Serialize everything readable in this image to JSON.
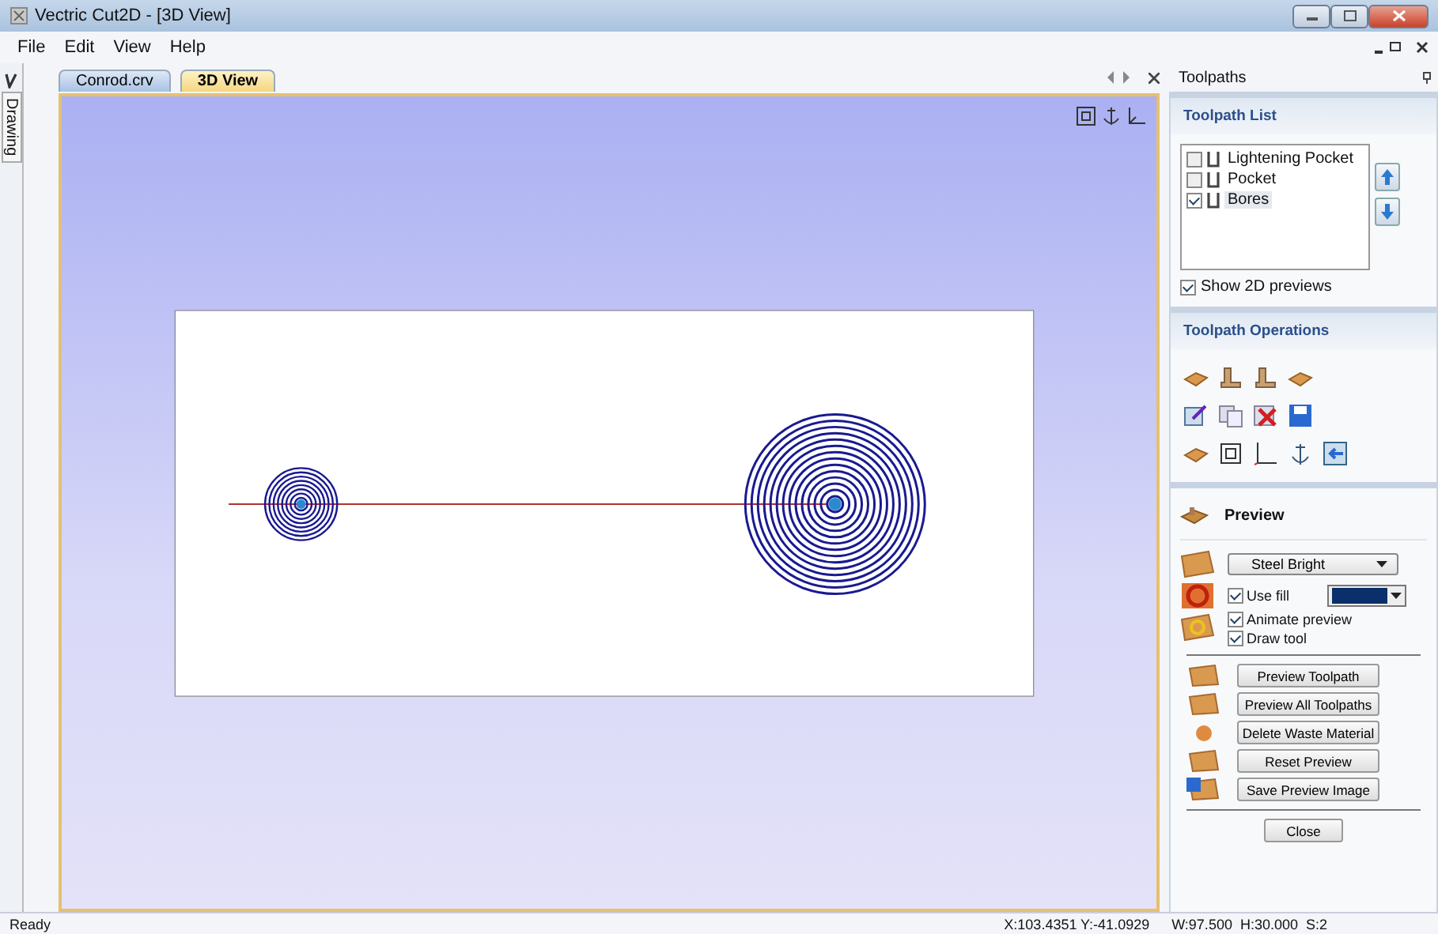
{
  "window": {
    "title": "Vectric Cut2D - [3D View]"
  },
  "menu": [
    "File",
    "Edit",
    "View",
    "Help"
  ],
  "left_dock": {
    "tab": "Drawing"
  },
  "tabs": [
    {
      "label": "Conrod.crv",
      "selected": false
    },
    {
      "label": "3D View",
      "selected": true
    }
  ],
  "toolpaths_panel": {
    "title": "Toolpaths",
    "list_title": "Toolpath List",
    "toolpaths": [
      {
        "name": "Lightening Pocket",
        "checked": false,
        "selected": false
      },
      {
        "name": "Pocket",
        "checked": false,
        "selected": false
      },
      {
        "name": "Bores",
        "checked": true,
        "selected": true
      }
    ],
    "show_2d_previews": {
      "label": "Show 2D previews",
      "checked": true
    },
    "operations_title": "Toolpath Operations",
    "preview": {
      "title": "Preview",
      "material": "Steel Bright",
      "options": [
        {
          "label": "Use fill",
          "checked": true
        },
        {
          "label": "Animate preview",
          "checked": true
        },
        {
          "label": "Draw tool",
          "checked": true
        }
      ],
      "buttons": [
        "Preview Toolpath",
        "Preview All Toolpaths",
        "Delete Waste Material",
        "Reset Preview",
        "Save Preview Image"
      ],
      "close": "Close"
    }
  },
  "status_bar": {
    "message": "Ready",
    "position": "X:103.4351 Y:-41.0929",
    "size": "W:97.500  H:30.000  S:2"
  }
}
